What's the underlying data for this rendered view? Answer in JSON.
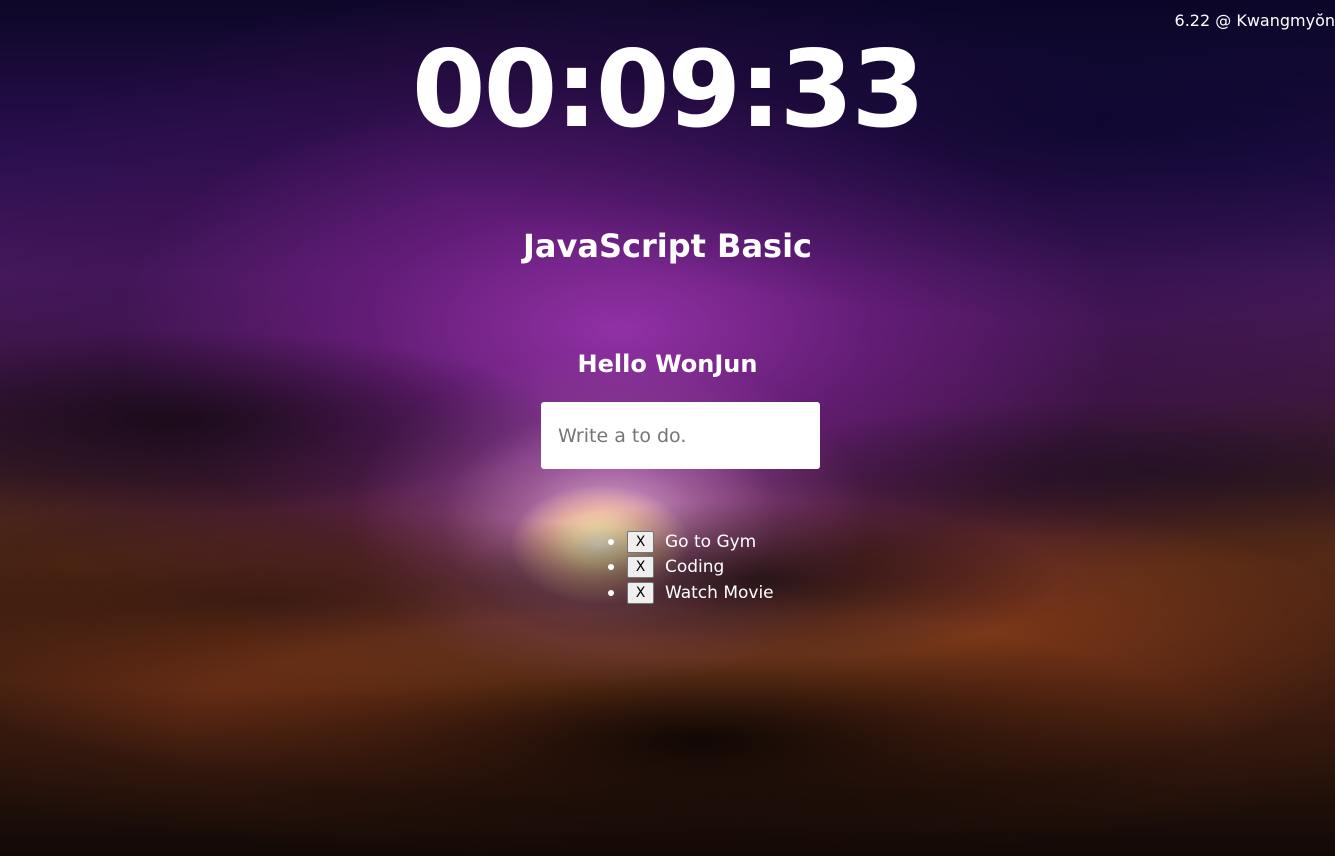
{
  "weather": {
    "text": "6.22 @ Kwangmyŏn"
  },
  "clock": {
    "time": "00:09:33"
  },
  "title": "JavaScript Basic",
  "greeting": "Hello WonJun",
  "todo_form": {
    "placeholder": "Write a to do.",
    "value": ""
  },
  "todos": [
    {
      "delete_label": "X",
      "text": "Go to Gym"
    },
    {
      "delete_label": "X",
      "text": "Coding"
    },
    {
      "delete_label": "X",
      "text": "Watch Movie"
    }
  ],
  "colors": {
    "text": "#ffffff",
    "input_background": "#ffffff",
    "button_background": "#efefef"
  }
}
